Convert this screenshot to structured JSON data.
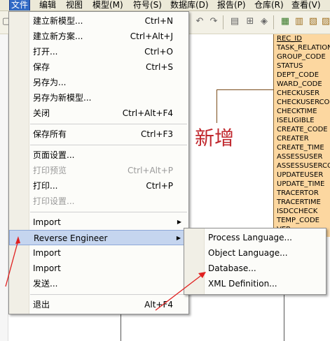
{
  "menubar": {
    "items": [
      {
        "label": "文件"
      },
      {
        "label": "编辑"
      },
      {
        "label": "视图"
      },
      {
        "label": "模型(M)"
      },
      {
        "label": "符号(S)"
      },
      {
        "label": "数据库(D)"
      },
      {
        "label": "报告(P)"
      },
      {
        "label": "仓库(R)"
      },
      {
        "label": "查看(V)"
      }
    ]
  },
  "file_menu": {
    "items": [
      {
        "label": "建立新模型...",
        "shortcut": "Ctrl+N"
      },
      {
        "label": "建立新方案...",
        "shortcut": "Ctrl+Alt+J"
      },
      {
        "label": "打开...",
        "shortcut": "Ctrl+O"
      },
      {
        "label": "保存",
        "shortcut": "Ctrl+S"
      },
      {
        "label": "另存为...",
        "shortcut": ""
      },
      {
        "label": "另存为新模型...",
        "shortcut": ""
      },
      {
        "label": "关闭",
        "shortcut": "Ctrl+Alt+F4"
      },
      {
        "label": "保存所有",
        "shortcut": "Ctrl+F3"
      },
      {
        "label": "页面设置...",
        "shortcut": ""
      },
      {
        "label": "打印预览",
        "shortcut": "Ctrl+Alt+P"
      },
      {
        "label": "打印...",
        "shortcut": "Ctrl+P"
      },
      {
        "label": "打印设置...",
        "shortcut": ""
      },
      {
        "label": "Import",
        "shortcut": ""
      },
      {
        "label": "Reverse Engineer",
        "shortcut": ""
      },
      {
        "label": "Import",
        "shortcut": ""
      },
      {
        "label": "Import",
        "shortcut": ""
      },
      {
        "label": "发送...",
        "shortcut": ""
      },
      {
        "label": "退出",
        "shortcut": "Alt+F4"
      }
    ]
  },
  "submenu": {
    "items": [
      {
        "label": "Process Language..."
      },
      {
        "label": "Object Language..."
      },
      {
        "label": "Database..."
      },
      {
        "label": "XML Definition..."
      }
    ]
  },
  "table_columns": [
    "REC_ID",
    "TASK_RELATION",
    "GROUP_CODE",
    "STATUS",
    "DEPT_CODE",
    "WARD_CODE",
    "CHECKUSER",
    "CHECKUSERCODE",
    "CHECKTIME",
    "ISELIGIBLE",
    "CREATE_CODE",
    "CREATER",
    "CREATE_TIME",
    "ASSESSUSER",
    "ASSESSUSERCODE",
    "UPDATEUSER",
    "UPDATE_TIME",
    "TRACERTOR",
    "TRACERTIME",
    "ISDCCHECK",
    "TEMP_CODE",
    "VER"
  ],
  "annotation": {
    "text": "新增"
  },
  "colors": {
    "annotation": "#c0272d",
    "table_fill": "#fcd7a0",
    "menu_highlight": "#c5d5ef"
  }
}
